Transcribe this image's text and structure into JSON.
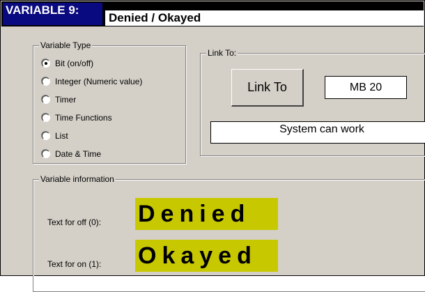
{
  "header": {
    "variable_label": "VARIABLE 9:",
    "variable_name": "Denied / Okayed"
  },
  "variable_type": {
    "legend": "Variable Type",
    "options": [
      {
        "label": "Bit (on/off)",
        "checked": true
      },
      {
        "label": "Integer (Numeric value)",
        "checked": false
      },
      {
        "label": "Timer",
        "checked": false
      },
      {
        "label": "Time Functions",
        "checked": false
      },
      {
        "label": "List",
        "checked": false
      },
      {
        "label": "Date & Time",
        "checked": false
      }
    ]
  },
  "link_to": {
    "legend": "Link To:",
    "button_label": "Link To",
    "address": "MB  20",
    "description": "System can work"
  },
  "variable_info": {
    "legend": "Variable information",
    "off_label": "Text for off (0):",
    "off_text": "Denied",
    "on_label": "Text for on (1):",
    "on_text": "Okayed",
    "highlight_color": "#c8c800"
  }
}
